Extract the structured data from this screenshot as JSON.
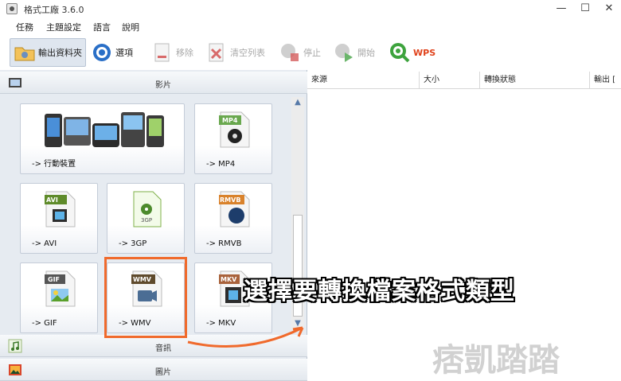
{
  "window": {
    "title": "格式工廠 3.6.0",
    "min": "—",
    "max": "☐",
    "close": "✕"
  },
  "menu": [
    "任務",
    "主題設定",
    "語言",
    "說明"
  ],
  "toolbar": {
    "output_folder": "輸出資料夾",
    "options": "選項",
    "remove": "移除",
    "clear_list": "清空列表",
    "stop": "停止",
    "start": "開始",
    "wps": "WPS"
  },
  "categories": {
    "video": "影片",
    "audio": "音訊",
    "image": "圖片"
  },
  "tiles": [
    {
      "label": "-> 行動裝置",
      "badge": ""
    },
    {
      "label": "-> MP4",
      "badge": "MP4"
    },
    {
      "label": "-> AVI",
      "badge": "AVI"
    },
    {
      "label": "-> 3GP",
      "badge": "3GP"
    },
    {
      "label": "-> RMVB",
      "badge": "RMVB"
    },
    {
      "label": "-> GIF",
      "badge": "GIF"
    },
    {
      "label": "-> WMV",
      "badge": "WMV"
    },
    {
      "label": "-> MKV",
      "badge": "MKV"
    }
  ],
  "columns": [
    "來源",
    "大小",
    "轉換狀態",
    "輸出 ["
  ],
  "annotation": "選擇要轉換檔案格式類型",
  "watermark": "痞凱踏踏",
  "colors": {
    "accent": "#f06a2c",
    "wps": "#e0421b",
    "panel": "#e6ebf1"
  }
}
